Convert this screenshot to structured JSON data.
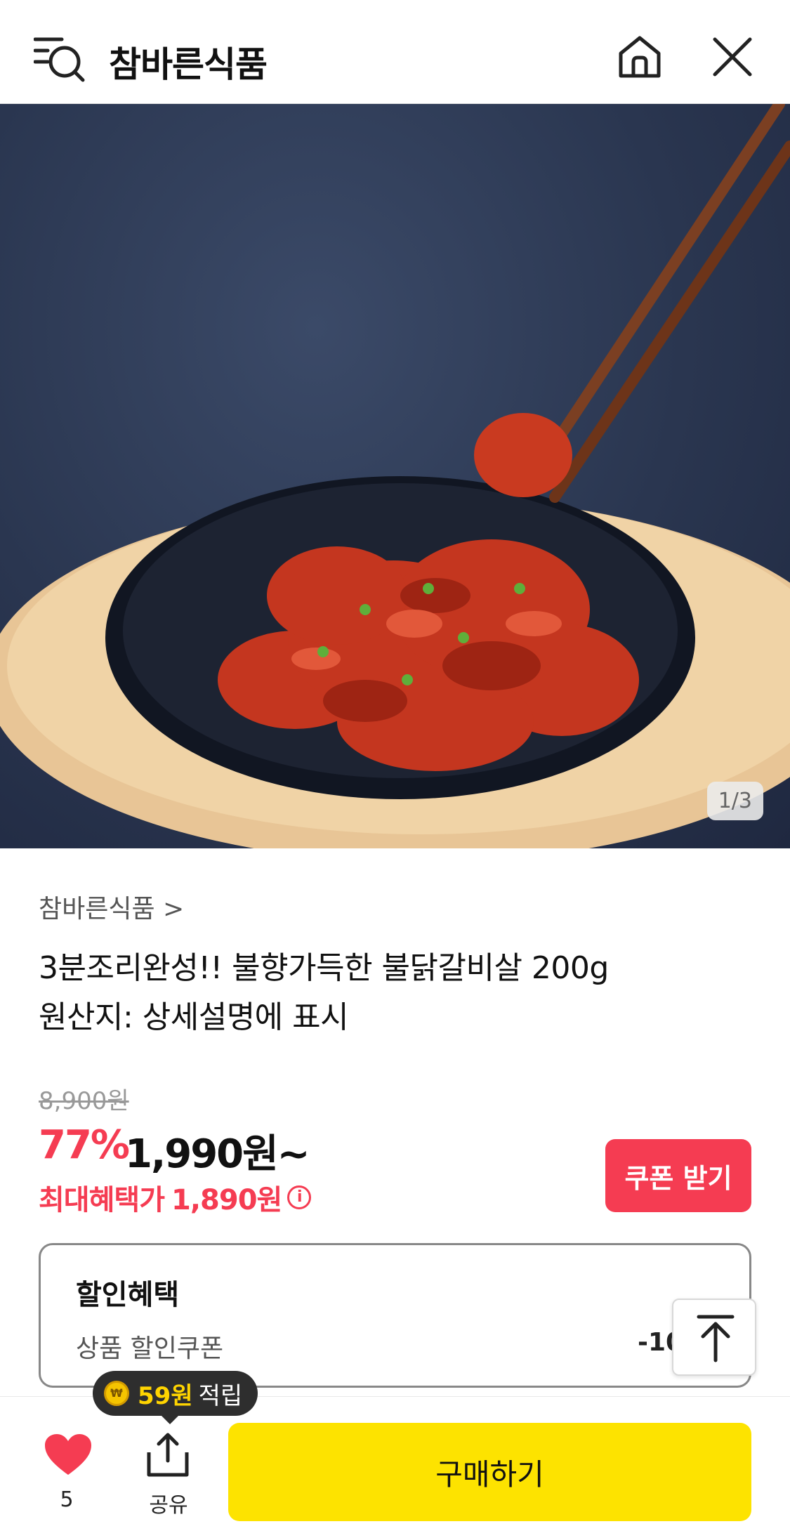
{
  "header": {
    "title": "참바른식품",
    "icons": {
      "left": "menu-search-icon",
      "home": "home-icon",
      "close": "close-icon"
    }
  },
  "gallery": {
    "counter": "1/3"
  },
  "product": {
    "seller": "참바른식품 >",
    "name_line1": "3분조리완성!! 불향가득한 불닭갈비살 200g",
    "name_line2": "원산지: 상세설명에 표시"
  },
  "pricing": {
    "original_price": "8,900원",
    "discount_rate": "77%",
    "sale_price": "1,990원~",
    "max_benefit_label": "최대혜택가",
    "max_benefit_price": "1,890원",
    "coupon_button": "쿠폰 받기"
  },
  "discount": {
    "title": "할인혜택",
    "row_label": "상품 할인쿠폰",
    "row_value": "-10"
  },
  "points_tooltip": {
    "amount": "59원",
    "label": "적립",
    "coin": "₩"
  },
  "bottom_bar": {
    "like_count": "5",
    "share_label": "공유",
    "buy_button": "구매하기"
  },
  "colors": {
    "accent": "#f53c52",
    "buy": "#fde300"
  }
}
